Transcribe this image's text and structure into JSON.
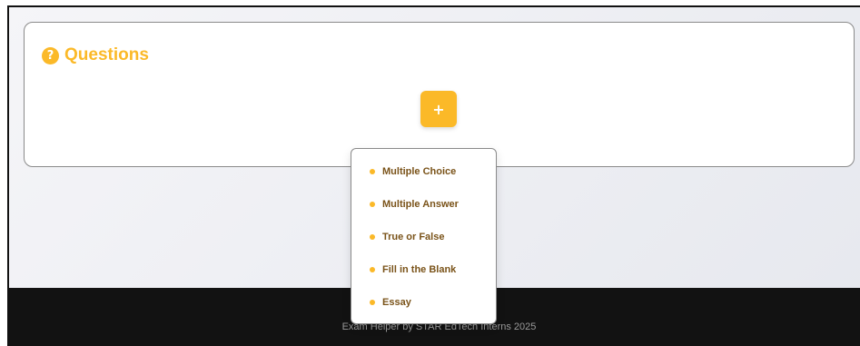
{
  "questions_card": {
    "help_icon_glyph": "?",
    "title": "Questions",
    "add_button_label": "+"
  },
  "dropdown": {
    "items": [
      {
        "label": "Multiple Choice"
      },
      {
        "label": "Multiple Answer"
      },
      {
        "label": "True or False"
      },
      {
        "label": "Fill in the Blank"
      },
      {
        "label": "Essay"
      }
    ]
  },
  "footer": {
    "text": "Exam Helper by STAR EdTech Interns 2025"
  },
  "colors": {
    "accent": "#fbb928",
    "menu_text": "#7a5319",
    "footer_bg": "#121212",
    "footer_text": "#9a9a9a"
  }
}
